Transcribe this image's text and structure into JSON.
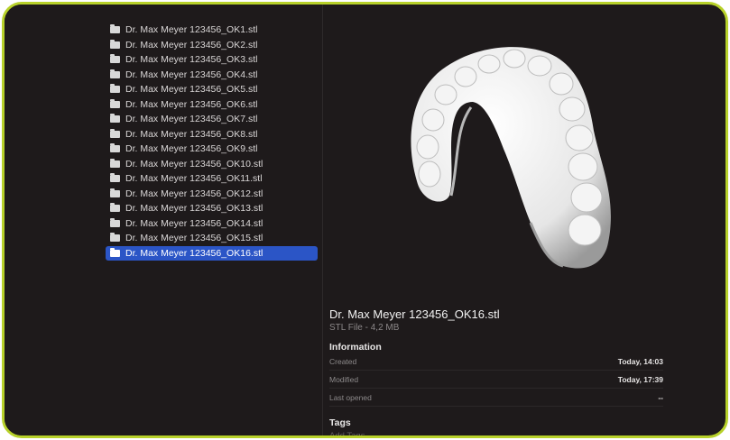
{
  "files": [
    "Dr. Max Meyer 123456_OK1.stl",
    "Dr. Max Meyer 123456_OK2.stl",
    "Dr. Max Meyer 123456_OK3.stl",
    "Dr. Max Meyer 123456_OK4.stl",
    "Dr. Max Meyer 123456_OK5.stl",
    "Dr. Max Meyer 123456_OK6.stl",
    "Dr. Max Meyer 123456_OK7.stl",
    "Dr. Max Meyer 123456_OK8.stl",
    "Dr. Max Meyer 123456_OK9.stl",
    "Dr. Max Meyer 123456_OK10.stl",
    "Dr. Max Meyer 123456_OK11.stl",
    "Dr. Max Meyer 123456_OK12.stl",
    "Dr. Max Meyer 123456_OK13.stl",
    "Dr. Max Meyer 123456_OK14.stl",
    "Dr. Max Meyer 123456_OK15.stl",
    "Dr. Max Meyer 123456_OK16.stl"
  ],
  "selected_index": 15,
  "preview": {
    "file_name": "Dr. Max Meyer 123456_OK16.stl",
    "file_kind": "STL File - 4,2 MB",
    "information_title": "Information",
    "created_label": "Created",
    "created_value": "Today, 14:03",
    "modified_label": "Modified",
    "modified_value": "Today, 17:39",
    "last_opened_label": "Last opened",
    "last_opened_value": "--",
    "tags_title": "Tags",
    "tags_placeholder": "Add Tags..."
  },
  "colors": {
    "frame_border": "#b7d12a",
    "background": "#1e1a1b",
    "selection": "#2b55c6"
  },
  "icons": {
    "file": "document-icon",
    "model": "dental-arch-model-icon"
  }
}
